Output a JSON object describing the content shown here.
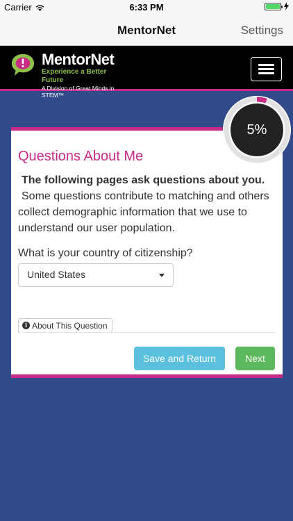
{
  "status_bar": {
    "carrier": "Carrier",
    "time": "6:33 PM"
  },
  "nav": {
    "title": "MentorNet",
    "settings_label": "Settings"
  },
  "brand": {
    "name": "MentorNet",
    "tagline": "Experience a Better Future",
    "subtitle": "A Division of Great Minds in STEM™"
  },
  "colors": {
    "accent": "#c72b86",
    "background": "#324a8a",
    "save_button": "#5bc0de",
    "next_button": "#5cb85c"
  },
  "progress": {
    "percent": 5,
    "label": "5%"
  },
  "card": {
    "title": "Questions About Me",
    "intro_bold": "The following pages ask questions about you.",
    "intro_text": "Some questions contribute to matching and others collect demographic information that we use to understand our user population.",
    "question": "What is your country of citizenship?",
    "selected_country": "United States",
    "about_label": "About This Question",
    "save_label": "Save and Return",
    "next_label": "Next"
  }
}
